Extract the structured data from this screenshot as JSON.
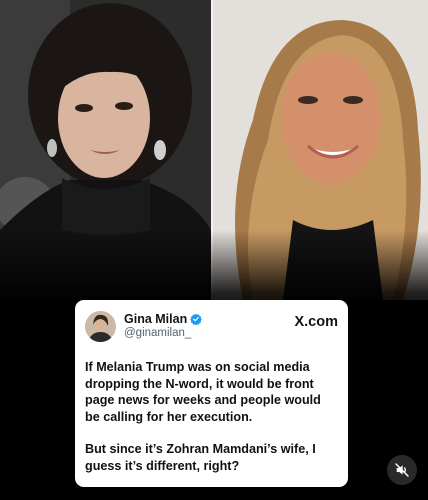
{
  "post": {
    "author_name": "Gina Milan",
    "author_handle": "@ginamilan_",
    "brand": "X.com",
    "paragraphs": [
      "If Melania Trump was on social media dropping the N-word, it would be front page news for weeks and people would be calling for her execution.",
      "But since it’s Zohran Mamdani’s wife, I guess it’s different, right?"
    ]
  },
  "icons": {
    "verified": "verified-badge-icon",
    "mute": "speaker-muted-icon"
  },
  "colors": {
    "verified": "#1d9bf0",
    "card_background": "#ffffff",
    "page_background": "#000000"
  }
}
